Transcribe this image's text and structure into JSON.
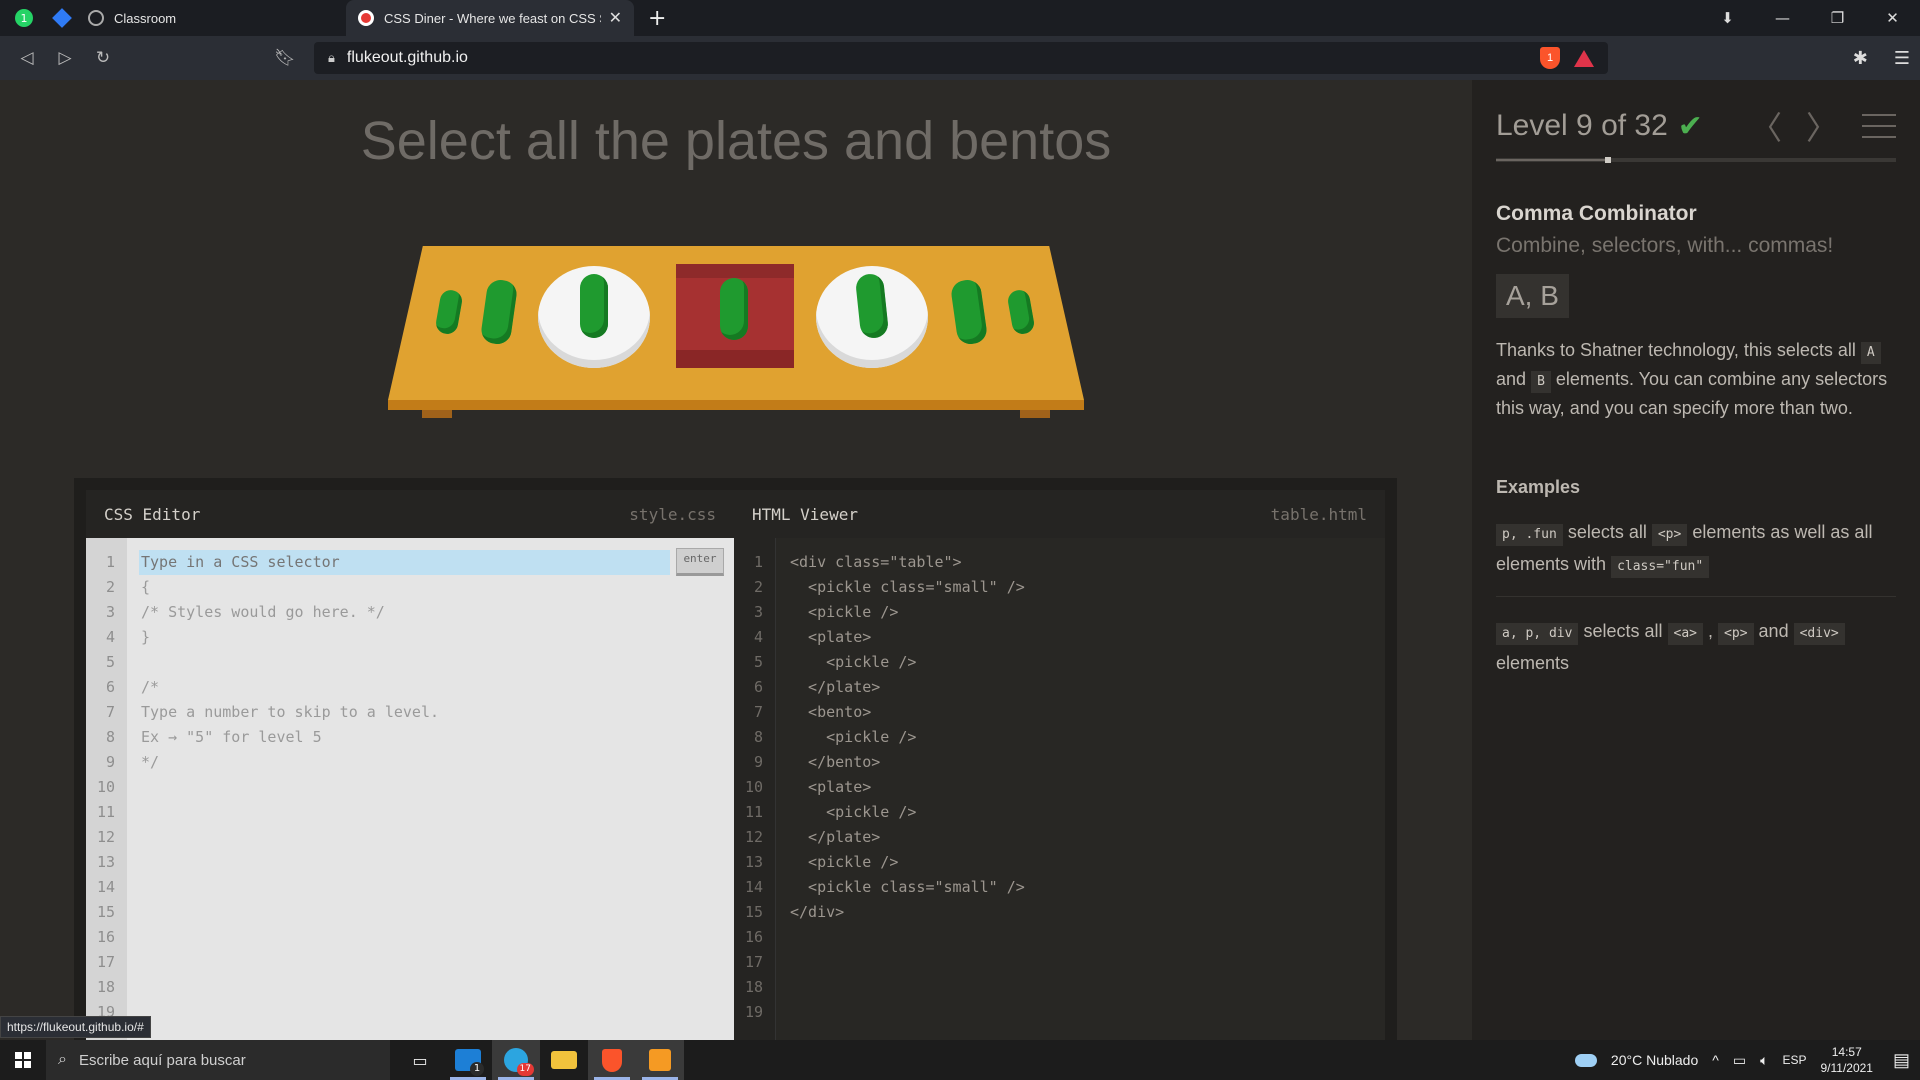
{
  "browser": {
    "tabs": [
      {
        "title": "Classroom",
        "active": false
      },
      {
        "title": "CSS Diner - Where we feast on CSS Selectors!",
        "active": true
      }
    ],
    "url": "flukeout.github.io",
    "shield_count": "1",
    "status_url": "https://flukeout.github.io/#",
    "whatsapp_badge": "1"
  },
  "game": {
    "instruction": "Select all the plates and bentos",
    "level_label": "Level 9 of 32",
    "progress_fraction": 0.28
  },
  "css_editor": {
    "title": "CSS Editor",
    "file": "style.css",
    "placeholder": "Type in a CSS selector",
    "enter_label": "enter",
    "line_numbers": [
      "1",
      "2",
      "3",
      "4",
      "5",
      "6",
      "7",
      "8",
      "9",
      "10",
      "11",
      "12",
      "13",
      "14",
      "15",
      "16",
      "17",
      "18",
      "19"
    ],
    "code_lines": [
      "",
      "{",
      "/* Styles would go here. */",
      "}",
      "",
      "/*",
      "Type a number to skip to a level.",
      "Ex → \"5\" for level 5",
      "*/"
    ]
  },
  "html_viewer": {
    "title": "HTML Viewer",
    "file": "table.html",
    "line_numbers": [
      "1",
      "2",
      "3",
      "4",
      "5",
      "6",
      "7",
      "8",
      "9",
      "10",
      "11",
      "12",
      "13",
      "14",
      "15",
      "16",
      "17",
      "18",
      "19"
    ],
    "code_lines": [
      "<div class=\"table\">",
      "  <pickle class=\"small\" />",
      "  <pickle />",
      "  <plate>",
      "    <pickle />",
      "  </plate>",
      "  <bento>",
      "    <pickle />",
      "  </bento>",
      "  <plate>",
      "    <pickle />",
      "  </plate>",
      "  <pickle />",
      "  <pickle class=\"small\" />",
      "</div>"
    ]
  },
  "sidebar": {
    "title": "Comma Combinator",
    "subtitle": "Combine, selectors, with... commas!",
    "syntax": "A, B",
    "desc_1": "Thanks to Shatner technology, this selects all",
    "desc_tag_a": "A",
    "desc_and": "and",
    "desc_tag_b": "B",
    "desc_2": "elements. You can combine any selectors this way, and you can specify more than two.",
    "examples_heading": "Examples",
    "ex1_code": "p, .fun",
    "ex1_t1": "selects all",
    "ex1_tag": "<p>",
    "ex1_t2": "elements as well as all elements with",
    "ex1_tag2": "class=\"fun\"",
    "ex2_code": "a, p, div",
    "ex2_t1": "selects all",
    "ex2_tag1": "<a>",
    "ex2_comma": ",",
    "ex2_tag2": "<p>",
    "ex2_and": "and",
    "ex2_tag3": "<div>",
    "ex2_t2": "elements"
  },
  "taskbar": {
    "search_placeholder": "Escribe aquí para buscar",
    "mail_badge": "1",
    "telegram_badge": "17",
    "weather": "20°C  Nublado",
    "lang": "ESP",
    "time": "14:57",
    "date": "9/11/2021"
  },
  "colors": {
    "table": "#e0a230",
    "pickle": "#1f9a2f",
    "bento": "#a63131",
    "check": "#4caf50"
  }
}
